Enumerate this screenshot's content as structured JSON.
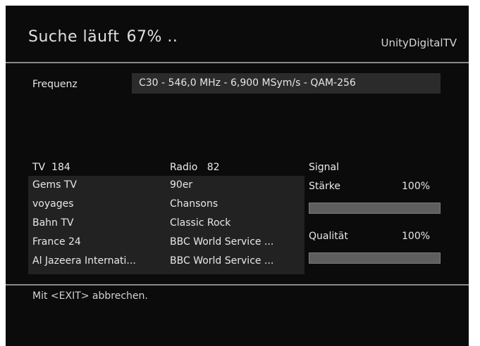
{
  "header": {
    "title": "Suche läuft",
    "progress_text": "67% ..",
    "progress": 0.67,
    "brand": "UnityDigitalTV"
  },
  "frequency": {
    "label": "Frequenz",
    "value": "C30 - 546,0 MHz - 6,900 MSym/s - QAM-256"
  },
  "tv": {
    "label": "TV",
    "count": "184",
    "channels": [
      "Gems TV",
      "voyages",
      "Bahn TV",
      "France 24",
      "Al Jazeera Internati..."
    ]
  },
  "radio": {
    "label": "Radio",
    "count": "82",
    "channels": [
      "90er",
      "Chansons",
      "Classic Rock",
      "BBC World Service ...",
      "BBC World Service ..."
    ]
  },
  "signal": {
    "label": "Signal",
    "strength_label": "Stärke",
    "strength_value": "100%",
    "strength": 1.0,
    "quality_label": "Qualität",
    "quality_value": "100%",
    "quality": 1.0
  },
  "footer": {
    "hint": "Mit <EXIT> abbrechen."
  },
  "colors": {
    "background": "#0b0b0b",
    "panel": "#222222",
    "text": "#e8e8e8",
    "bar_fill": "#5e5e5e"
  }
}
